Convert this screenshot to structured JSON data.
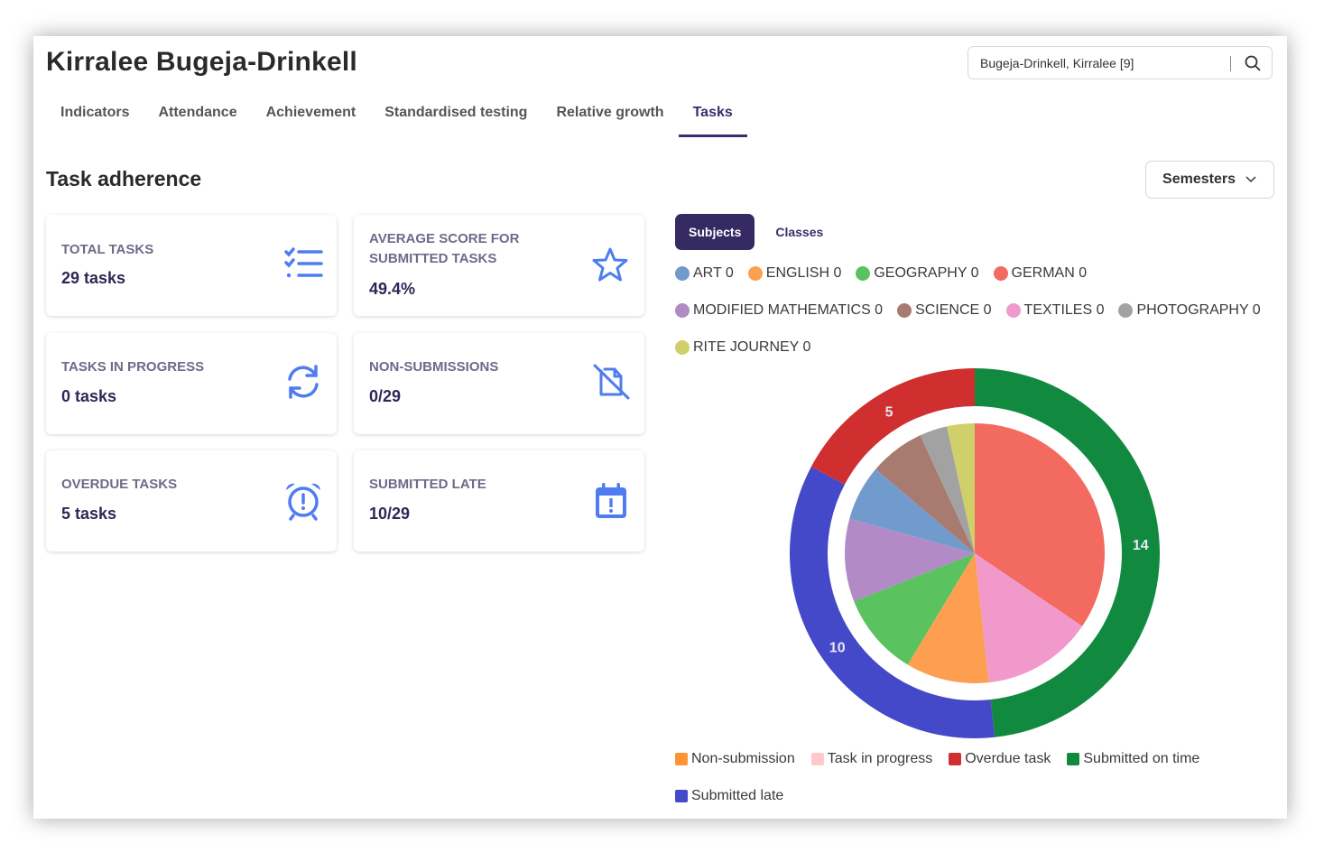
{
  "header": {
    "title": "Kirralee Bugeja-Drinkell",
    "search_value": "Bugeja-Drinkell, Kirralee [9]",
    "search_icon": "search-icon"
  },
  "tabs": [
    {
      "label": "Indicators"
    },
    {
      "label": "Attendance"
    },
    {
      "label": "Achievement"
    },
    {
      "label": "Standardised testing"
    },
    {
      "label": "Relative growth"
    },
    {
      "label": "Tasks",
      "active": true
    }
  ],
  "section": {
    "title": "Task adherence",
    "period_select": "Semesters"
  },
  "cards": [
    {
      "label": "TOTAL TASKS",
      "value": "29 tasks",
      "icon": "checklist-icon"
    },
    {
      "label": "AVERAGE SCORE FOR SUBMITTED TASKS",
      "value": "49.4%",
      "icon": "star-icon"
    },
    {
      "label": "TASKS IN PROGRESS",
      "value": "0 tasks",
      "icon": "refresh-icon"
    },
    {
      "label": "NON-SUBMISSIONS",
      "value": "0/29",
      "icon": "file-off-icon"
    },
    {
      "label": "OVERDUE TASKS",
      "value": "5 tasks",
      "icon": "alarm-clock-icon"
    },
    {
      "label": "SUBMITTED LATE",
      "value": "10/29",
      "icon": "calendar-alert-icon"
    }
  ],
  "chart_toggle": {
    "subjects": "Subjects",
    "classes": "Classes",
    "active": "Subjects"
  },
  "colors": {
    "accent": "#352a62",
    "icon": "#4f7df0"
  },
  "chart_data": {
    "type": "pie",
    "subject_legend": [
      {
        "label": "ART 0",
        "color": "#729bcd"
      },
      {
        "label": "ENGLISH 0",
        "color": "#fd9e50"
      },
      {
        "label": "GEOGRAPHY 0",
        "color": "#5bc260"
      },
      {
        "label": "GERMAN 0",
        "color": "#f26a60"
      },
      {
        "label": "MODIFIED MATHEMATICS 0",
        "color": "#b28ac6"
      },
      {
        "label": "SCIENCE 0",
        "color": "#a87b70"
      },
      {
        "label": "TEXTILES 0",
        "color": "#f299cb"
      },
      {
        "label": "PHOTOGRAPHY 0",
        "color": "#a2a2a2"
      },
      {
        "label": "RITE JOURNEY 0",
        "color": "#cfd06a"
      }
    ],
    "inner_slices": [
      {
        "subject": "GERMAN",
        "value": 10,
        "color": "#f26a60"
      },
      {
        "subject": "TEXTILES",
        "value": 4,
        "color": "#f299cb"
      },
      {
        "subject": "ENGLISH",
        "value": 3,
        "color": "#fd9e50"
      },
      {
        "subject": "GEOGRAPHY",
        "value": 3,
        "color": "#5bc260"
      },
      {
        "subject": "MODIFIED MATHEMATICS",
        "value": 3,
        "color": "#b28ac6"
      },
      {
        "subject": "ART",
        "value": 2,
        "color": "#729bcd"
      },
      {
        "subject": "SCIENCE",
        "value": 2,
        "color": "#a87b70"
      },
      {
        "subject": "PHOTOGRAPHY",
        "value": 1,
        "color": "#a2a2a2"
      },
      {
        "subject": "RITE JOURNEY",
        "value": 1,
        "color": "#cfd06a"
      }
    ],
    "outer_ring": [
      {
        "name": "Submitted on time",
        "value": 14,
        "label": "14",
        "color": "#118a40"
      },
      {
        "name": "Submitted late",
        "value": 10,
        "label": "10",
        "color": "#4349c8"
      },
      {
        "name": "Overdue task",
        "value": 5,
        "label": "5",
        "color": "#d02f2f"
      }
    ],
    "status_legend": [
      {
        "label": "Non-submission",
        "color": "#fd9632"
      },
      {
        "label": "Task in progress",
        "color": "#ffc9cc"
      },
      {
        "label": "Overdue task",
        "color": "#d02f2f"
      },
      {
        "label": "Submitted on time",
        "color": "#118a40"
      },
      {
        "label": "Submitted late",
        "color": "#4349c8"
      }
    ]
  }
}
